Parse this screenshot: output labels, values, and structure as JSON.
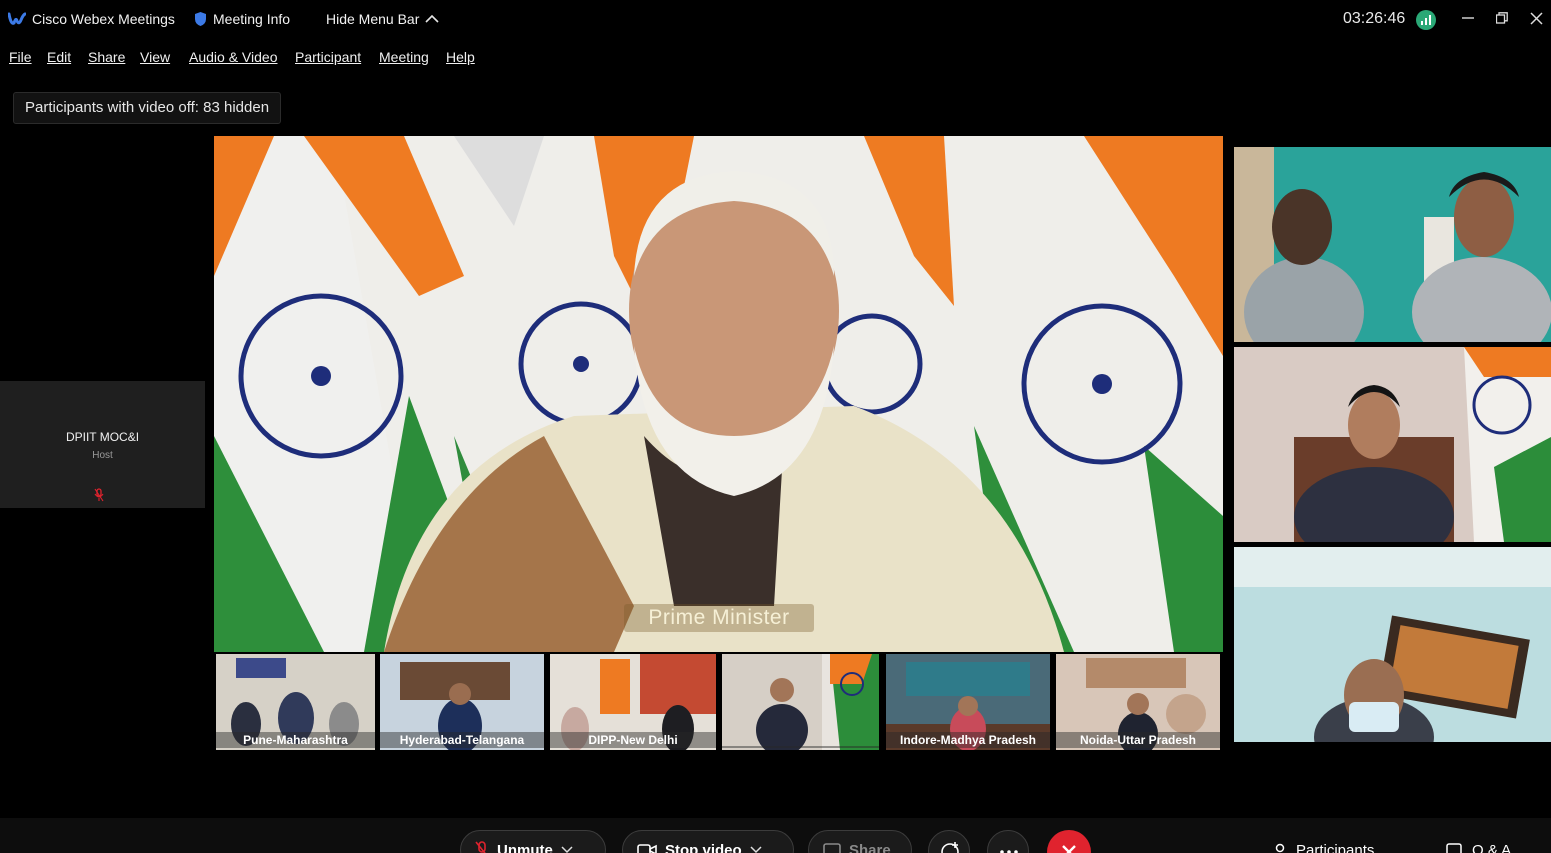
{
  "titlebar": {
    "app_name": "Cisco Webex Meetings",
    "meeting_info": "Meeting Info",
    "hide_menu_bar": "Hide Menu Bar",
    "clock": "03:26:46",
    "colors": {
      "webex_blue": "#3c7ae6",
      "network_green": "#2aa876",
      "end_red": "#e0232e"
    }
  },
  "menu": {
    "items": [
      {
        "label": "File"
      },
      {
        "label": "Edit"
      },
      {
        "label": "Share"
      },
      {
        "label": "View"
      },
      {
        "label": "Audio & Video"
      },
      {
        "label": "Participant"
      },
      {
        "label": "Meeting"
      },
      {
        "label": "Help"
      }
    ]
  },
  "hidden_participants": "Participants with video off: 83 hidden",
  "host_tile": {
    "name": "DPIIT MOC&I",
    "role": "Host"
  },
  "main_video": {
    "speaker_label": "Prime Minister"
  },
  "filmstrip": [
    {
      "label": "Pune-Maharashtra"
    },
    {
      "label": "Hyderabad-Telangana"
    },
    {
      "label": "DIPP-New Delhi"
    },
    {
      "label": ""
    },
    {
      "label": "Indore-Madhya Pradesh"
    },
    {
      "label": "Noida-Uttar Pradesh"
    }
  ],
  "controls": {
    "unmute": "Unmute",
    "stop_video": "Stop video",
    "share": "Share",
    "participants": "Participants",
    "qa": "Q & A"
  }
}
